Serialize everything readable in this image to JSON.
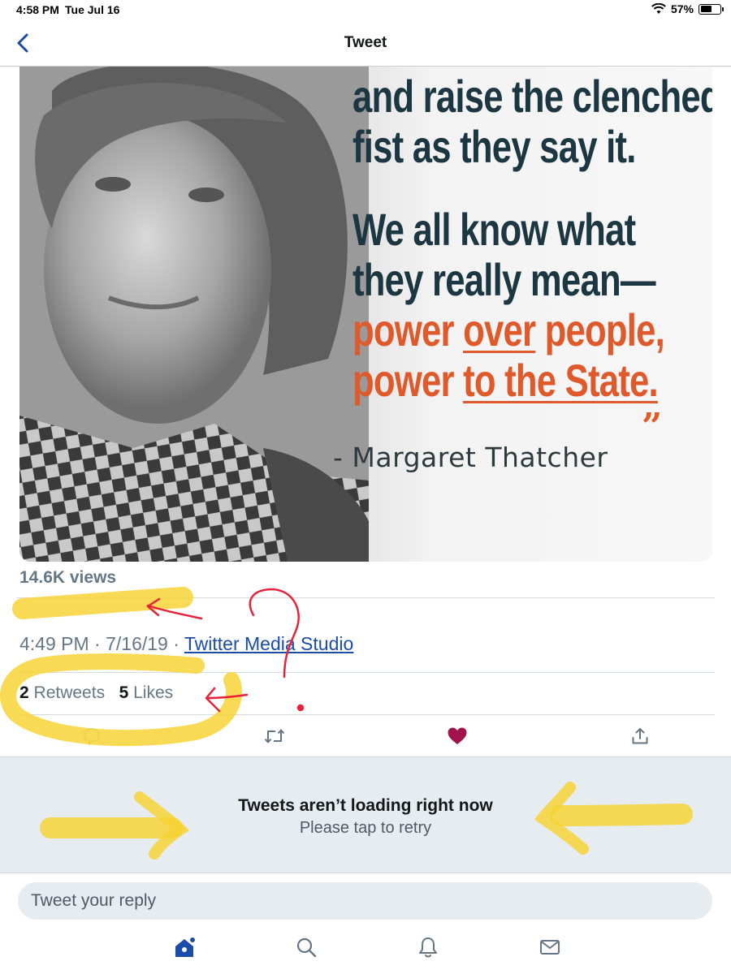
{
  "status": {
    "time": "4:58 PM",
    "date": "Tue Jul 16",
    "battery": "57%",
    "battery_level": 0.57
  },
  "nav": {
    "title": "Tweet"
  },
  "media": {
    "quote_lines": [
      "and raise the clenched",
      "fist as they say it.",
      "We all know what",
      "they really mean—",
      "power over people,",
      "power to the State."
    ],
    "quote_mark": "”",
    "attribution": "- Margaret Thatcher"
  },
  "tweet": {
    "views": "14.6K views",
    "time": "4:49 PM",
    "date": "7/16/19",
    "source": "Twitter Media Studio",
    "retweets_count": "2",
    "retweets_label": "Retweets",
    "likes_count": "5",
    "likes_label": "Likes"
  },
  "actions": {
    "icons": [
      "reply-icon",
      "retweet-icon",
      "like-icon",
      "share-icon"
    ],
    "liked_color": "#a2124d",
    "icon_color": "#657786",
    "reply_icon_color": "#c8d0b0"
  },
  "retry": {
    "title": "Tweets aren’t loading right now",
    "subtitle": "Please tap to retry"
  },
  "reply": {
    "placeholder": "Tweet your reply"
  },
  "tabbar": {
    "icons": [
      "home-icon",
      "search-icon",
      "notifications-icon",
      "messages-icon"
    ],
    "accent": "#1b4da8"
  },
  "annotation_colors": {
    "highlighter": "#f7d230",
    "pen": "#e8223a"
  }
}
